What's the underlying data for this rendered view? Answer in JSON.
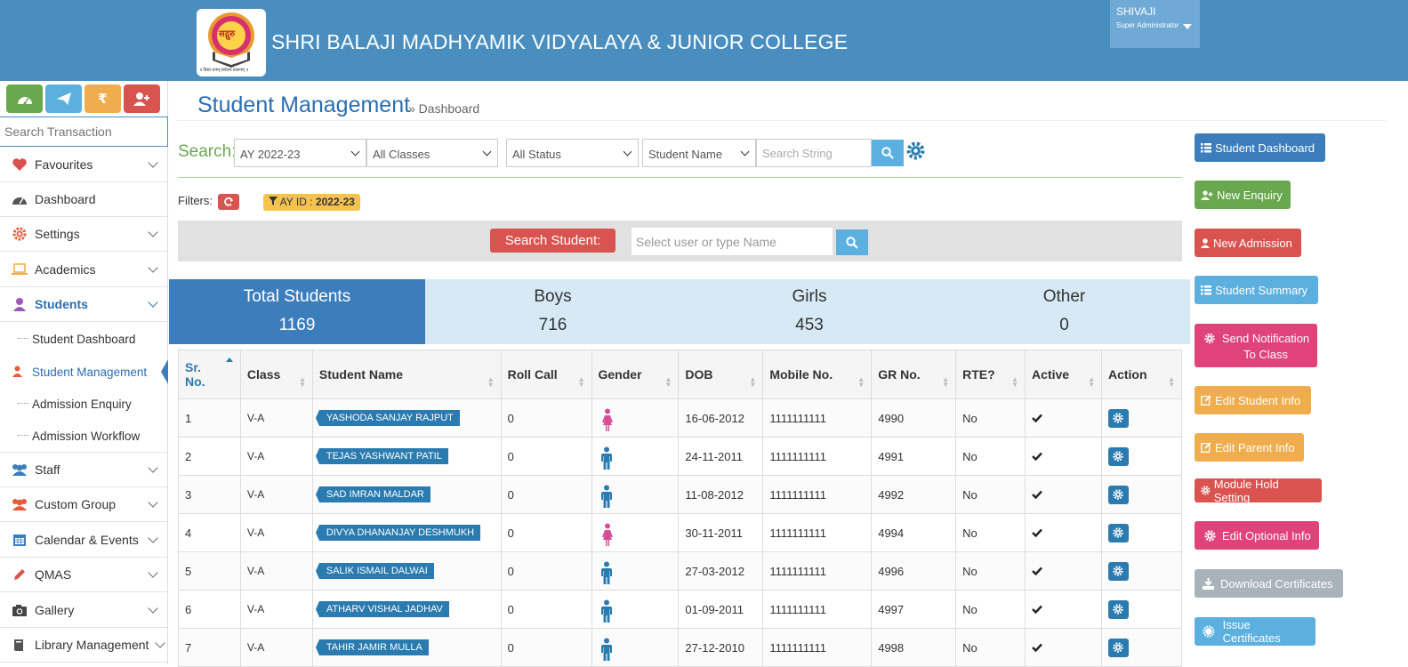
{
  "header": {
    "school_name": "SHRI BALAJI MADHYAMIK VIDYALAYA & JUNIOR COLLEGE",
    "logo_text": "सद्गुरु",
    "logo_motto": "॥ विद्या धनम् सर्वधन प्रधानम् ॥",
    "user_name": "SHIVAJI",
    "user_role": "Super Administrator"
  },
  "sidebar": {
    "quick_actions": [
      {
        "name": "dashboard-quick-button",
        "icon": "tachometer-icon",
        "color": "#6aa84f"
      },
      {
        "name": "send-quick-button",
        "icon": "paper-plane-icon",
        "color": "#5bb0e0"
      },
      {
        "name": "fees-quick-button",
        "icon": "rupee-icon",
        "color": "#f0ad4e"
      },
      {
        "name": "add-user-quick-button",
        "icon": "user-plus-icon",
        "color": "#d9534f"
      }
    ],
    "search_placeholder": "Search Transaction",
    "items": [
      {
        "label": "Favourites"
      },
      {
        "label": "Dashboard"
      },
      {
        "label": "Settings"
      },
      {
        "label": "Academics"
      },
      {
        "label": "Students"
      },
      {
        "label": "Staff"
      },
      {
        "label": "Custom Group"
      },
      {
        "label": "Calendar & Events"
      },
      {
        "label": "QMAS"
      },
      {
        "label": "Gallery"
      },
      {
        "label": "Library Management"
      }
    ],
    "sub_items": [
      {
        "label": "Student Dashboard"
      },
      {
        "label": "Student Management"
      },
      {
        "label": "Admission Enquiry"
      },
      {
        "label": "Admission Workflow"
      }
    ]
  },
  "page": {
    "title": "Student Management",
    "breadcrumb": "» Dashboard"
  },
  "search": {
    "label": "Search:",
    "academic_year": "AY 2022-23",
    "classes": "All Classes",
    "status": "All Status",
    "field": "Student Name",
    "string_placeholder": "Search String"
  },
  "filters": {
    "label": "Filters:",
    "ay_prefix": "AY ID : ",
    "ay_value": "2022-23"
  },
  "student_search": {
    "button_label": "Search Student:",
    "placeholder": "Select user or type Name"
  },
  "stats": [
    {
      "label": "Total Students",
      "value": "1169"
    },
    {
      "label": "Boys",
      "value": "716"
    },
    {
      "label": "Girls",
      "value": "453"
    },
    {
      "label": "Other",
      "value": "0"
    }
  ],
  "table": {
    "headers": {
      "sr_1": "Sr.",
      "sr_2": "No.",
      "class": "Class",
      "name": "Student Name",
      "roll": "Roll Call",
      "gender": "Gender",
      "dob": "DOB",
      "mobile": "Mobile No.",
      "gr": "GR No.",
      "rte": "RTE?",
      "active": "Active",
      "action": "Action"
    },
    "rows": [
      {
        "sr": "1",
        "class": "V-A",
        "name": "YASHODA SANJAY RAJPUT",
        "roll": "0",
        "gender": "female",
        "dob": "16-06-2012",
        "mobile": "1111111111",
        "gr": "4990",
        "rte": "No"
      },
      {
        "sr": "2",
        "class": "V-A",
        "name": "TEJAS YASHWANT PATIL",
        "roll": "0",
        "gender": "male",
        "dob": "24-11-2011",
        "mobile": "1111111111",
        "gr": "4991",
        "rte": "No"
      },
      {
        "sr": "3",
        "class": "V-A",
        "name": "SAD IMRAN MALDAR",
        "roll": "0",
        "gender": "male",
        "dob": "11-08-2012",
        "mobile": "1111111111",
        "gr": "4992",
        "rte": "No"
      },
      {
        "sr": "4",
        "class": "V-A",
        "name": "DIVYA DHANANJAY DESHMUKH",
        "roll": "0",
        "gender": "female",
        "dob": "30-11-2011",
        "mobile": "1111111111",
        "gr": "4994",
        "rte": "No"
      },
      {
        "sr": "5",
        "class": "V-A",
        "name": "SALIK ISMAIL DALWAI",
        "roll": "0",
        "gender": "male",
        "dob": "27-03-2012",
        "mobile": "1111111111",
        "gr": "4996",
        "rte": "No"
      },
      {
        "sr": "6",
        "class": "V-A",
        "name": "ATHARV VISHAL JADHAV",
        "roll": "0",
        "gender": "male",
        "dob": "01-09-2011",
        "mobile": "1111111111",
        "gr": "4997",
        "rte": "No"
      },
      {
        "sr": "7",
        "class": "V-A",
        "name": "TAHIR JAMIR MULLA",
        "roll": "0",
        "gender": "male",
        "dob": "27-12-2010",
        "mobile": "1111111111",
        "gr": "4998",
        "rte": "No"
      }
    ]
  },
  "right_actions": [
    {
      "label": "Student Dashboard",
      "color": "#3c7ebc"
    },
    {
      "label": "New Enquiry",
      "color": "#6aa84f"
    },
    {
      "label": "New Admission",
      "color": "#d9534f"
    },
    {
      "label": "Student Summary",
      "color": "#5bb0e0"
    },
    {
      "label": "Send Notification To Class",
      "color": "#e0427a"
    },
    {
      "label": "Edit Student Info",
      "color": "#f0ad4e"
    },
    {
      "label": "Edit Parent Info",
      "color": "#f0ad4e"
    },
    {
      "label": "Module Hold Setting",
      "color": "#d9534f"
    },
    {
      "label": "Edit Optional Info",
      "color": "#e0427a"
    },
    {
      "label": "Download Certificates",
      "color": "#a8b3ba"
    },
    {
      "label": "Issue Certificates",
      "color": "#5bb0e0"
    }
  ],
  "colors": {
    "header_bg": "#4a8ebf",
    "primary": "#2a7bb0",
    "female_icon": "#d44d96",
    "male_icon": "#2a7bb0"
  }
}
